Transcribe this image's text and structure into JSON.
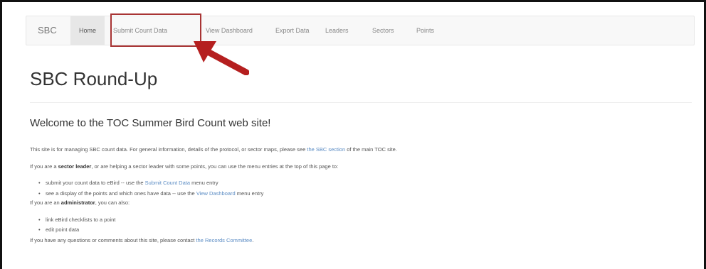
{
  "nav": {
    "brand": "SBC",
    "items": [
      "Home",
      "Submit Count Data",
      "View Dashboard",
      "Export Data",
      "Leaders",
      "Sectors",
      "Points"
    ]
  },
  "page": {
    "title": "SBC Round-Up",
    "welcome": "Welcome to the TOC Summer Bird Count web site!"
  },
  "content": {
    "p1_pre": "This site is for managing SBC count data. For general information, details of the protocol, or sector maps, please see ",
    "p1_link": "the SBC section",
    "p1_post": " of the main TOC site.",
    "p2_pre": "If you are a ",
    "p2_bold": "sector leader",
    "p2_post": ", or are helping a sector leader with some points, you can use the menu entries at the top of this page to:",
    "li1_pre": "submit your count data to eBird -- use the ",
    "li1_link": "Submit Count Data",
    "li1_post": " menu entry",
    "li2_pre": "see a display of the points and which ones have data -- use the ",
    "li2_link": "View Dashboard",
    "li2_post": " menu entry",
    "p3_pre": "If you are an ",
    "p3_bold": "administrator",
    "p3_post": ", you can also:",
    "li3": "link eBird checklists to a point",
    "li4": "edit point data",
    "p4_pre": "If you have any questions or comments about this site, please contact ",
    "p4_link": "the Records Committee",
    "p4_post": "."
  },
  "colors": {
    "highlight_box": "#a83434",
    "arrow": "#b51f1f",
    "link": "#5b8cc4"
  }
}
